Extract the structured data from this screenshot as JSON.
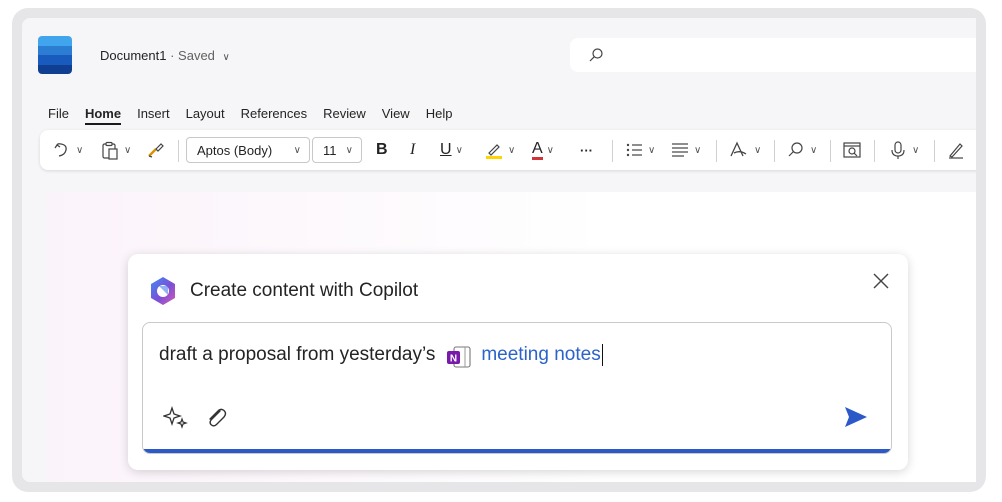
{
  "app": {
    "doc_name": "Document1",
    "separator": " · ",
    "save_status": "Saved",
    "chevron": "∨",
    "logo_icon": "word-logo-icon",
    "colors": {
      "logo": [
        "#41a5ee",
        "#2b7cd3",
        "#185abd",
        "#103f91"
      ]
    }
  },
  "search": {
    "icon": "search-icon"
  },
  "menu": {
    "items": [
      "File",
      "Home",
      "Insert",
      "Layout",
      "References",
      "Review",
      "View",
      "Help"
    ],
    "active": "Home"
  },
  "ribbon": {
    "font_name": "Aptos (Body)",
    "font_size": "11",
    "bold": "B",
    "italic": "I",
    "underline": "U",
    "font_color_letter": "A",
    "more": "···",
    "colors": {
      "highlight": "#ffd400",
      "font_color": "#d13438"
    }
  },
  "copilot": {
    "title": "Create content with Copilot",
    "prompt_text": "draft a proposal from yesterday’s",
    "mention_text": "meeting notes",
    "mention_icon": "onenote-icon",
    "onenote_letter": "N",
    "colors": {
      "accent": "#2c58c8",
      "mention": "#2b63c9",
      "onenote": "#7719aa"
    }
  }
}
